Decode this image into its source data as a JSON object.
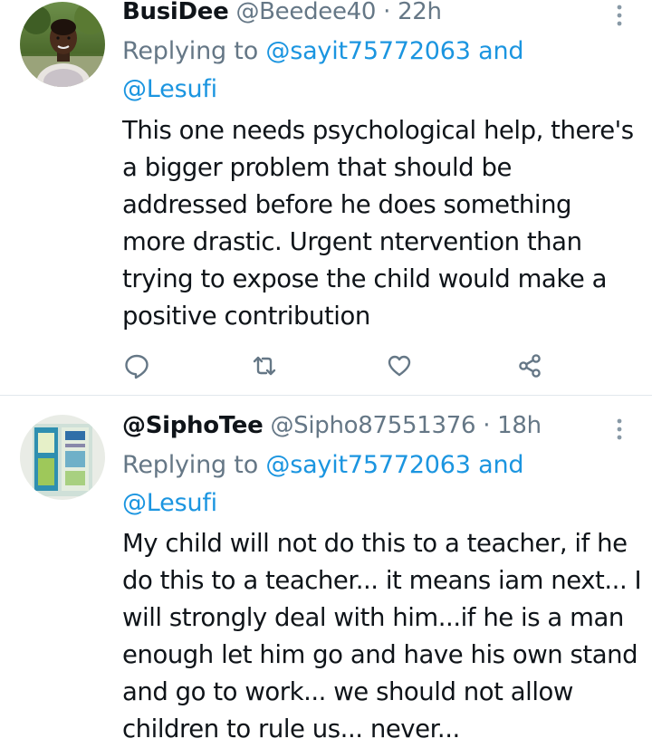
{
  "tweets": [
    {
      "display_name": "BusiDee",
      "handle": "@Beedee40",
      "separator": "·",
      "time": "22h",
      "replying_to_prefix": "Replying to",
      "replying_to_first": "@sayit75772063",
      "replying_to_and": "and",
      "replying_to_second": "@Lesufi",
      "body_lines": [
        "This one needs psychological help, there's",
        "a bigger problem that should be",
        "addressed before he does something",
        "more drastic. Urgent ntervention than",
        "trying to expose the child would make a",
        "positive contribution"
      ],
      "actions": [
        "reply-icon",
        "retweet-icon",
        "like-icon",
        "share-icon"
      ]
    },
    {
      "display_name": "@SiphoTee",
      "handle": "@Sipho87551376",
      "separator": "·",
      "time": "18h",
      "replying_to_prefix": "Replying to",
      "replying_to_first": "@sayit75772063",
      "replying_to_and": "and",
      "replying_to_second": "@Lesufi",
      "body_lines": [
        "My child will not do this to a teacher, if he",
        "do this to a teacher... it means iam next... I",
        "will strongly deal with him...if he is a man",
        "enough let him go and have his own stand",
        "and go to work... we should not allow",
        "children to rule us... never..."
      ]
    }
  ],
  "colors": {
    "text": "#0f1419",
    "secondary": "#657786",
    "link": "#1b95e0",
    "divider": "#e1e8ed"
  }
}
